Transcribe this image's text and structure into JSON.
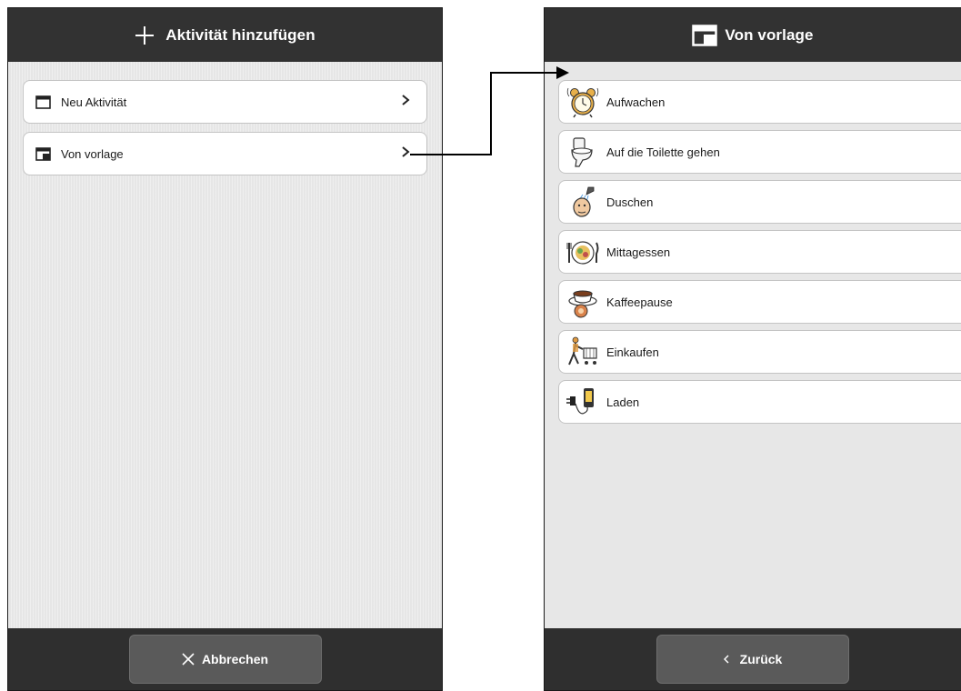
{
  "left_panel": {
    "header": {
      "title": "Aktivität hinzufügen",
      "icon": "plus-icon"
    },
    "items": [
      {
        "label": "Neu Aktivität",
        "icon": "calendar-icon"
      },
      {
        "label": "Von vorlage",
        "icon": "template-calendar-icon"
      }
    ],
    "footer": {
      "button_label": "Abbrechen",
      "icon": "close-icon"
    }
  },
  "right_panel": {
    "header": {
      "title": "Von vorlage",
      "icon": "template-calendar-icon"
    },
    "templates": [
      {
        "label": "Aufwachen",
        "icon": "alarm-clock-icon"
      },
      {
        "label": "Auf die Toilette gehen",
        "icon": "toilet-icon"
      },
      {
        "label": "Duschen",
        "icon": "shower-icon"
      },
      {
        "label": "Mittagessen",
        "icon": "lunch-plate-icon"
      },
      {
        "label": "Kaffeepause",
        "icon": "coffee-cup-icon"
      },
      {
        "label": "Einkaufen",
        "icon": "shopping-cart-icon"
      },
      {
        "label": "Laden",
        "icon": "phone-charger-icon"
      }
    ],
    "footer": {
      "button_label": "Zurück",
      "icon": "chevron-left-icon"
    }
  },
  "colors": {
    "header_bg": "#323232",
    "footer_bg": "#2f2f2f",
    "button_bg": "#5a5a5a",
    "content_bg": "#e7e7e7",
    "item_bg": "#ffffff"
  }
}
